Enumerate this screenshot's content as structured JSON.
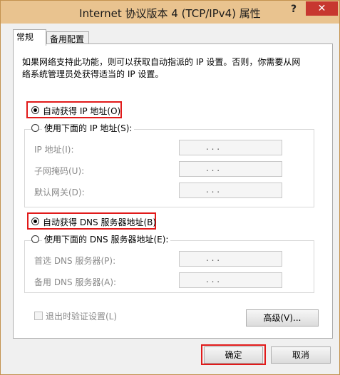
{
  "window": {
    "title": "Internet 协议版本 4 (TCP/IPv4) 属性",
    "help_label": "?",
    "close_label": "✕"
  },
  "tabs": [
    {
      "label": "常规",
      "active": true
    },
    {
      "label": "备用配置",
      "active": false
    }
  ],
  "description": "如果网络支持此功能，则可以获取自动指派的 IP 设置。否则，你需要从网络系统管理员处获得适当的 IP 设置。",
  "ip_section": {
    "auto_label": "自动获得 IP 地址(O)",
    "auto_selected": true,
    "manual_label": "使用下面的 IP 地址(S):",
    "fields": [
      {
        "label": "IP 地址(I):",
        "value": ". . ."
      },
      {
        "label": "子网掩码(U):",
        "value": ". . ."
      },
      {
        "label": "默认网关(D):",
        "value": ". . ."
      }
    ]
  },
  "dns_section": {
    "auto_label": "自动获得 DNS 服务器地址(B)",
    "auto_selected": true,
    "manual_label": "使用下面的 DNS 服务器地址(E):",
    "fields": [
      {
        "label": "首选 DNS 服务器(P):",
        "value": ". . ."
      },
      {
        "label": "备用 DNS 服务器(A):",
        "value": ". . ."
      }
    ]
  },
  "validate_label": "退出时验证设置(L)",
  "advanced_label": "高级(V)...",
  "ok_label": "确定",
  "cancel_label": "取消",
  "colors": {
    "titlebar": "#e9c38f",
    "close": "#c7372f",
    "highlight": "#e11a1a"
  }
}
